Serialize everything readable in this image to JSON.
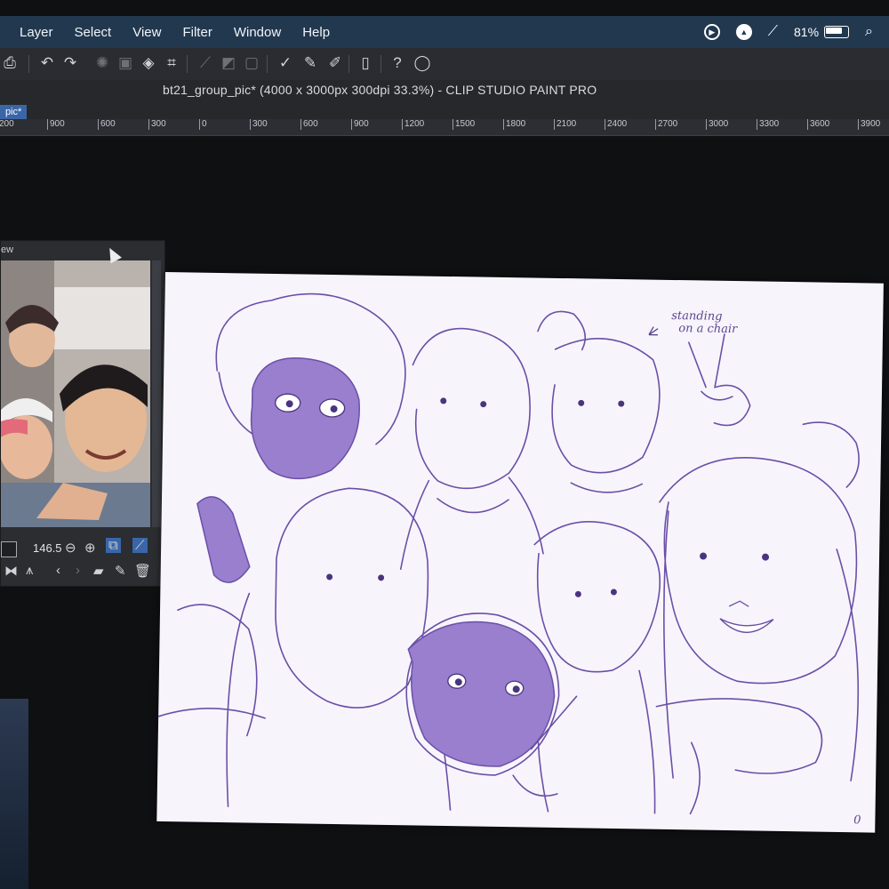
{
  "menu": {
    "items": [
      "Layer",
      "Select",
      "View",
      "Filter",
      "Window",
      "Help"
    ]
  },
  "status": {
    "battery": "81%",
    "icons": [
      "play-circle-icon",
      "compass-icon",
      "pen-off-icon",
      "battery-icon",
      "search-icon"
    ]
  },
  "toolbar": {
    "icons": [
      "stamp-icon",
      "undo-icon",
      "redo-icon",
      "clear-icon",
      "transform-icon",
      "fill-icon",
      "crop-icon",
      "select-icon",
      "grid-icon",
      "hatch-icon",
      "frame-icon",
      "pen-check-icon",
      "brush-icon",
      "pen-icon",
      "tablet-icon",
      "help-icon",
      "lasso-icon"
    ]
  },
  "title": "bt21_group_pic* (4000 x 3000px 300dpi 33.3%)  - CLIP STUDIO PAINT PRO",
  "tab": "pic*",
  "ruler": [
    "200",
    "900",
    "600",
    "300",
    "0",
    "300",
    "600",
    "900",
    "1200",
    "1500",
    "1800",
    "2100",
    "2400",
    "2700",
    "3000",
    "3300",
    "3600",
    "3900"
  ],
  "navigator": {
    "title": "ew",
    "zoom": "146.5"
  },
  "canvas": {
    "annotation": "standing\n  on a chair",
    "signature": "0"
  },
  "colors": {
    "menubar": "#21384f",
    "sketch": "#6b4fa8",
    "fill": "#9a7fcf"
  }
}
